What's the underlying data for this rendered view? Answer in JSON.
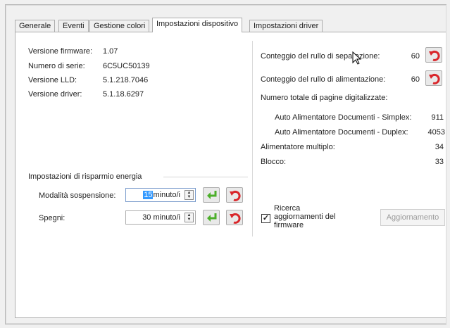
{
  "tabs": [
    {
      "label": "Generale"
    },
    {
      "label": "Eventi"
    },
    {
      "label": "Gestione colori"
    },
    {
      "label": "Impostazioni dispositivo"
    },
    {
      "label": "Impostazioni driver"
    }
  ],
  "device_info": {
    "firmware_label": "Versione firmware:",
    "firmware_value": "1.07",
    "serial_label": "Numero di serie:",
    "serial_value": "6C5UC50139",
    "lld_label": "Versione LLD:",
    "lld_value": "5.1.218.7046",
    "driver_label": "Versione driver:",
    "driver_value": "5.1.18.6297"
  },
  "power_saving": {
    "group_title": "Impostazioni di risparmio energia",
    "sleep_label": "Modalità sospensione:",
    "sleep_number": "15",
    "sleep_unit": "minuto/i",
    "off_label": "Spegni:",
    "off_value": "30 minuto/i"
  },
  "counters": {
    "separation_label": "Conteggio del rullo di separazione:",
    "separation_value": "60",
    "feed_label": "Conteggio del rullo di alimentazione:",
    "feed_value": "60",
    "total_label": "Numero totale di pagine digitalizzate:",
    "simplex_label": "Auto Alimentatore Documenti - Simplex:",
    "simplex_value": "911",
    "duplex_label": "Auto Alimentatore Documenti - Duplex:",
    "duplex_value": "4053",
    "multifeed_label": "Alimentatore multiplo:",
    "multifeed_value": "34",
    "jam_label": "Blocco:",
    "jam_value": "33"
  },
  "firmware_update": {
    "checkbox_label_1": "Ricerca",
    "checkbox_label_2": "aggiornamenti del",
    "checkbox_label_3": "firmware",
    "checked": true,
    "update_button": "Aggiornamento"
  },
  "colors": {
    "accept_green": "#4caf2a",
    "reset_red": "#d9262b",
    "selection_blue": "#3399ff"
  }
}
